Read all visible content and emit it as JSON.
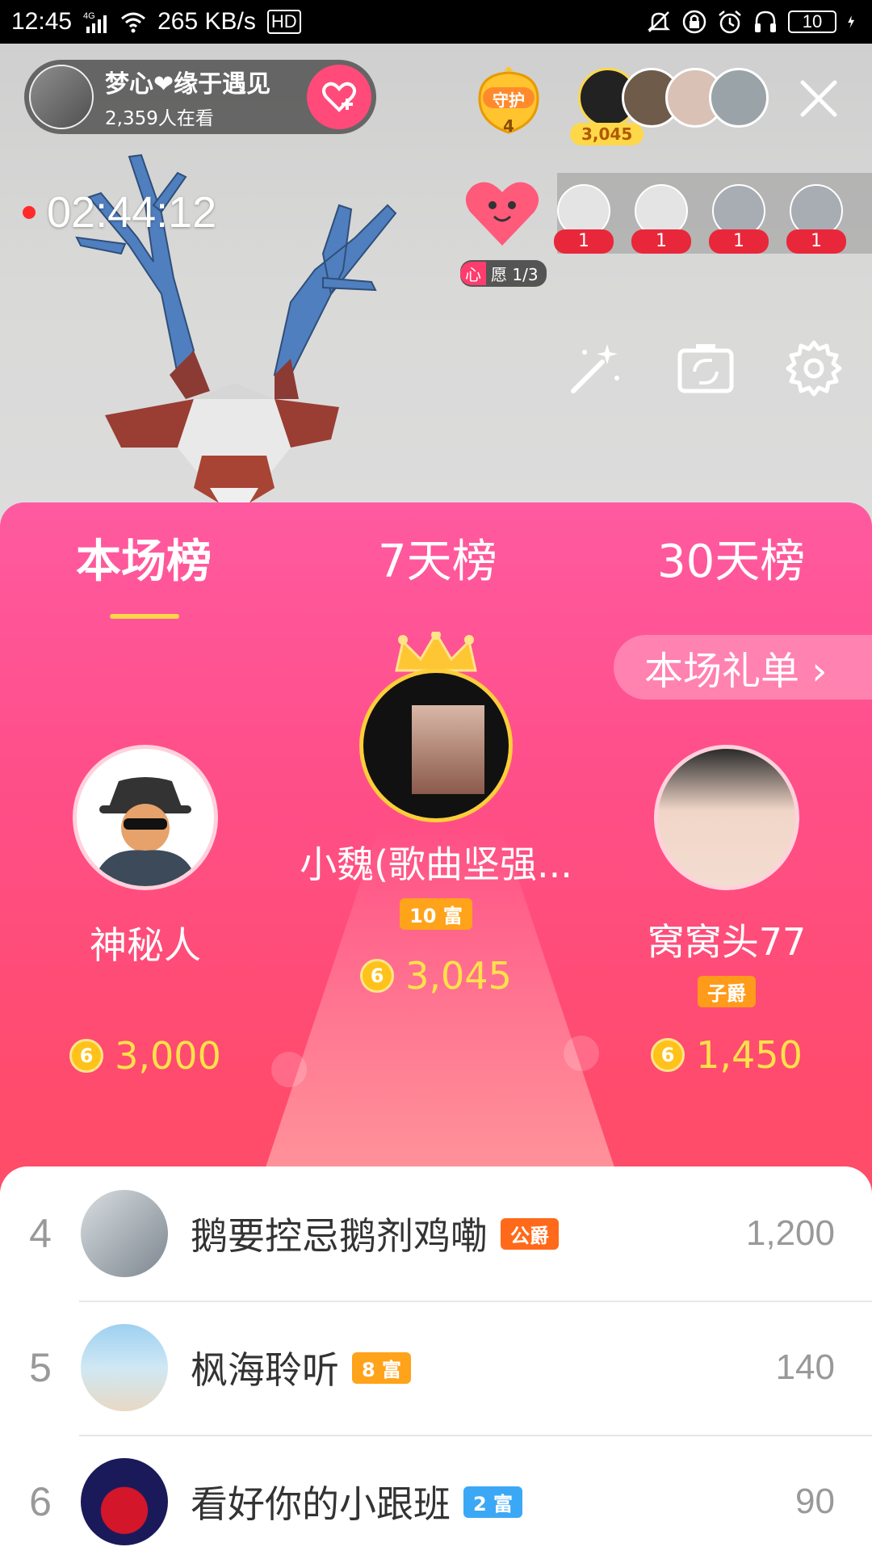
{
  "status_bar": {
    "time": "12:45",
    "network": "4G",
    "speed": "265 KB/s",
    "hd": "HD",
    "battery": "10"
  },
  "live": {
    "anchor_name": "梦心❤缘于遇见",
    "viewers": "2,359人在看",
    "guard_label": "守护",
    "guard_count": "4",
    "top_fan_score": "3,045",
    "timer": "02:44:12",
    "wish_tag": "心",
    "wish_text": "愿 1/3",
    "gifters": [
      {
        "count": "1"
      },
      {
        "count": "1"
      },
      {
        "count": "1"
      },
      {
        "count": "1"
      }
    ]
  },
  "tabs": [
    {
      "label": "本场榜",
      "active": true
    },
    {
      "label": "7天榜",
      "active": false
    },
    {
      "label": "30天榜",
      "active": false
    }
  ],
  "gift_list_button": "本场礼单 ›",
  "podium": {
    "first": {
      "name": "小魏(歌曲坚强...",
      "badge": "10 富",
      "score": "3,045",
      "rank": "1"
    },
    "second": {
      "name": "神秘人",
      "score": "3,000",
      "rank": "2"
    },
    "third": {
      "name": "窝窝头77",
      "badge": "子爵",
      "score": "1,450",
      "rank": "3"
    }
  },
  "coin_symbol": "6",
  "list": [
    {
      "rank": "4",
      "name": "鹅要控忌鹅剂鸡嘞",
      "badge": "公爵",
      "value": "1,200"
    },
    {
      "rank": "5",
      "name": "枫海聆听",
      "badge": "8 富",
      "value": "140"
    },
    {
      "rank": "6",
      "name": "看好你的小跟班",
      "badge": "2 富",
      "value": "90"
    }
  ],
  "colors": {
    "panel_pink": "#ff5aa0",
    "accent_red": "#ff4b6d",
    "gold": "#ffe24a",
    "badge_orange": "#ffa31a",
    "badge_blue": "#3ba8f5"
  }
}
